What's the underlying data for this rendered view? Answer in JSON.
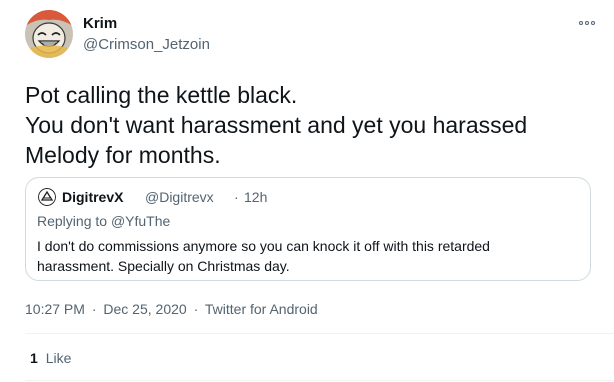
{
  "tweet": {
    "author": {
      "name": "Krim",
      "handle": "@Crimson_Jetzoin"
    },
    "text_lines": [
      "Pot calling the kettle black.",
      "You don't want harassment and yet you harassed",
      "Melody for months."
    ],
    "quoted": {
      "author_name": "DigitrevX",
      "author_handle": "@Digitrevx",
      "separator": "·",
      "time": "12h",
      "replying_prefix": "Replying to",
      "replying_handle": "@YfuThe",
      "text_lines": [
        "I don't do commissions anymore so you can knock it off with this retarded",
        "harassment. Specially on Christmas day."
      ]
    },
    "meta": {
      "time": "10:27 PM",
      "separator": "·",
      "date": "Dec 25, 2020",
      "source": "Twitter for Android"
    },
    "likes": {
      "count": "1",
      "label": "Like"
    }
  },
  "colors": {
    "text": "#0f1419",
    "secondary": "#536471",
    "border": "#cfd9de",
    "divider": "#eff3f4"
  },
  "icons": {
    "more": "more-horizontal-icon",
    "avatar": "avatar-image",
    "quoted_avatar": "avatar-image"
  }
}
